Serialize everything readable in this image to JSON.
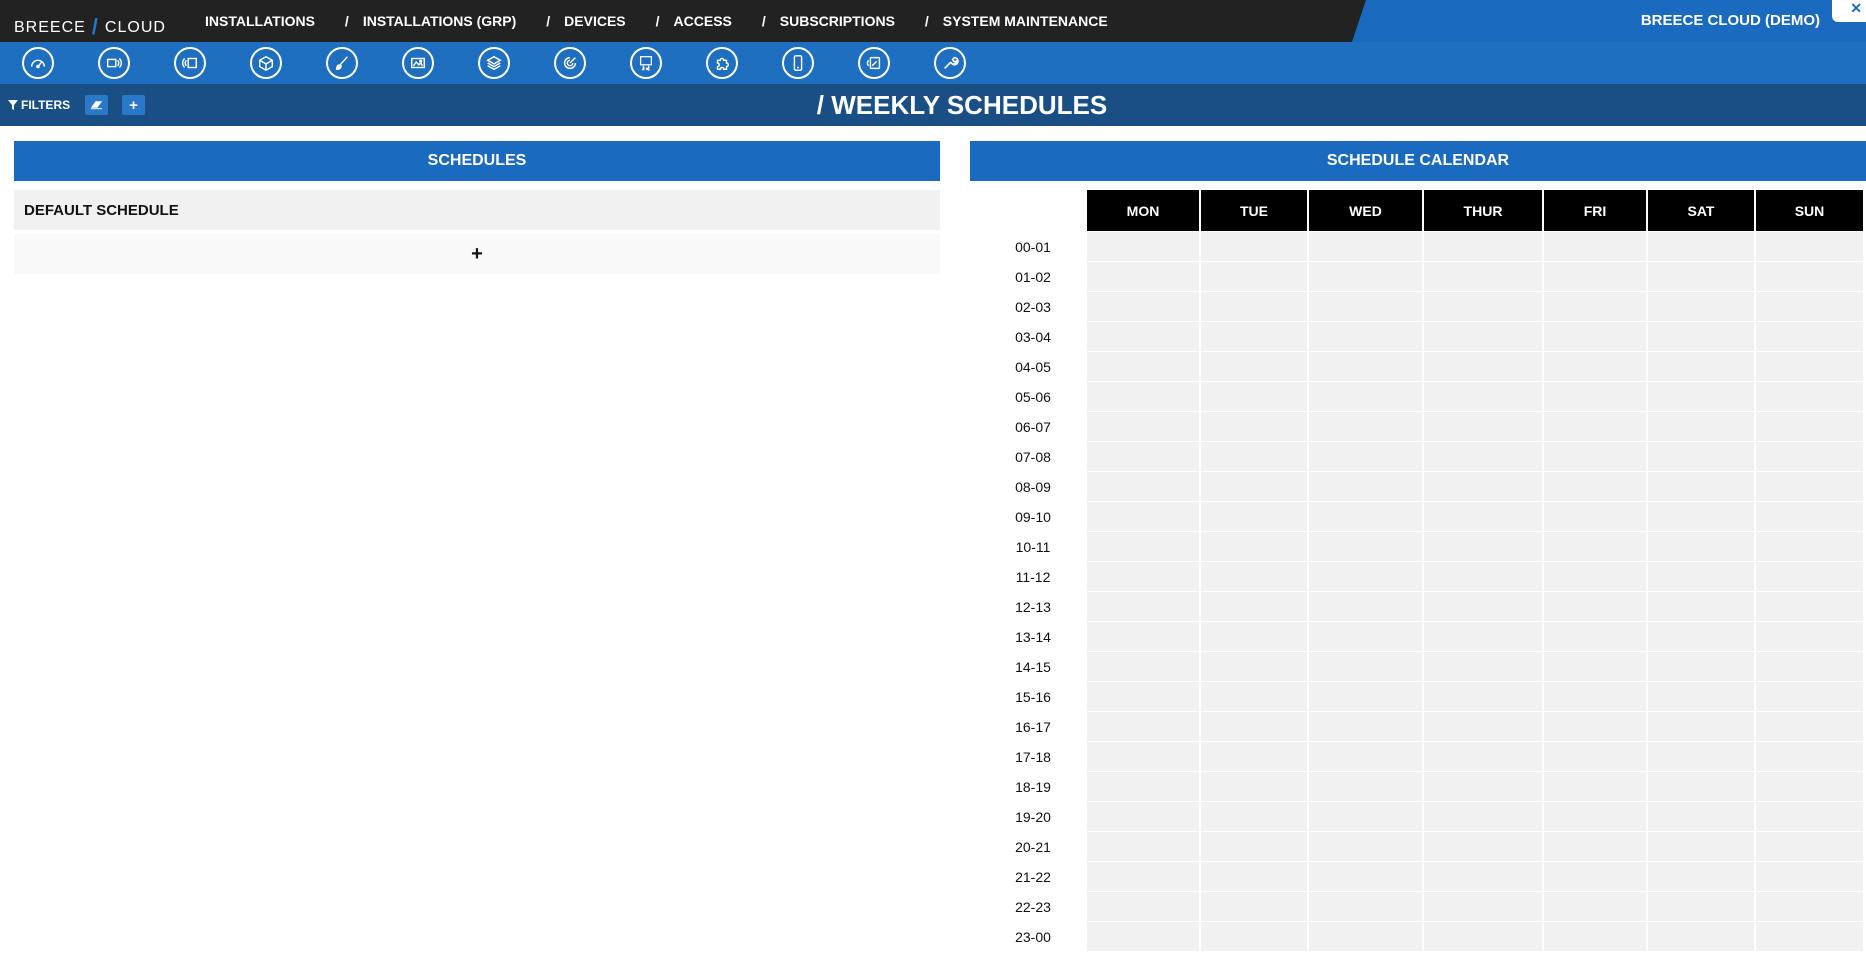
{
  "app": {
    "logo_left": "BREECE",
    "logo_slash": "/",
    "logo_right": "CLOUD",
    "brand_title": "BREECE CLOUD (DEMO)",
    "close_glyph": "✕"
  },
  "nav": {
    "separator": "/",
    "items": [
      {
        "label": "INSTALLATIONS"
      },
      {
        "label": "INSTALLATIONS (GRP)"
      },
      {
        "label": "DEVICES"
      },
      {
        "label": "ACCESS"
      },
      {
        "label": "SUBSCRIPTIONS"
      },
      {
        "label": "SYSTEM MAINTENANCE"
      }
    ]
  },
  "toolbar": {
    "icons": [
      "dashboard-icon",
      "signage-icon",
      "cast-icon",
      "box-icon",
      "brush-icon",
      "media-icon",
      "layers-icon",
      "radar-icon",
      "4k-display-icon",
      "puzzle-icon",
      "phone-icon",
      "tablet-icon",
      "wrench-icon"
    ]
  },
  "filters": {
    "label": "FILTERS",
    "add_label": "+"
  },
  "page": {
    "title": "/ WEEKLY SCHEDULES"
  },
  "schedules": {
    "header": "SCHEDULES",
    "items": [
      "DEFAULT SCHEDULE"
    ],
    "add_label": "+"
  },
  "calendar": {
    "header": "SCHEDULE CALENDAR",
    "days": [
      "MON",
      "TUE",
      "WED",
      "THUR",
      "FRI",
      "SAT",
      "SUN"
    ],
    "hours": [
      "00-01",
      "01-02",
      "02-03",
      "03-04",
      "04-05",
      "05-06",
      "06-07",
      "07-08",
      "08-09",
      "09-10",
      "10-11",
      "11-12",
      "12-13",
      "13-14",
      "14-15",
      "15-16",
      "16-17",
      "17-18",
      "18-19",
      "19-20",
      "20-21",
      "21-22",
      "22-23",
      "23-00"
    ]
  },
  "colors": {
    "top_bar": "#222222",
    "accent": "#1a6bbf",
    "toolbar": "#1e6fc0",
    "title_bar": "#1a4f86",
    "cell": "#f1f1f1"
  }
}
